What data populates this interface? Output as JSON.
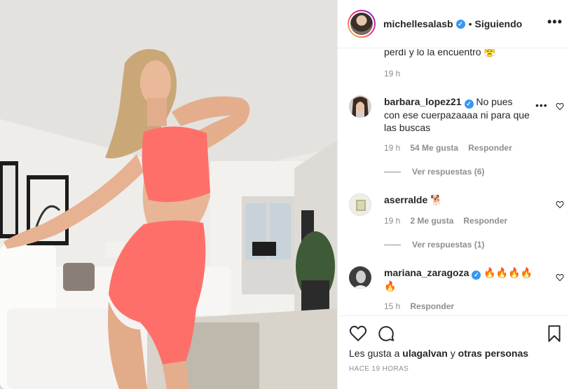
{
  "post": {
    "author": "michellesalasb",
    "verified_mark": "✓",
    "separator": "•",
    "follow_status": "Siguiendo",
    "more_label": "•••"
  },
  "comments": [
    {
      "text": "perdí y lo la encuentro 😤",
      "time": "19 h"
    },
    {
      "user": "barbara_lopez21",
      "text": "No pues con ese cuerpazaaaa ni para que las buscas",
      "time": "19 h",
      "likes": "54 Me gusta",
      "reply": "Responder",
      "view_replies": "Ver respuestas (6)"
    },
    {
      "user": "aserralde",
      "text": "🐕",
      "time": "19 h",
      "likes": "2 Me gusta",
      "reply": "Responder",
      "view_replies": "Ver respuestas (1)"
    },
    {
      "user": "mariana_zaragoza",
      "text": "🔥🔥🔥🔥🔥",
      "time": "15 h",
      "reply": "Responder"
    }
  ],
  "footer": {
    "likes_prefix": "Les gusta a",
    "likes_user": "ulagalvan",
    "likes_connector": "y",
    "likes_others": "otras personas",
    "time_ago": "HACE 19 HORAS"
  },
  "icons": {
    "like": "heart-icon",
    "comment": "comment-icon",
    "save": "bookmark-icon",
    "more": "more-options-icon"
  },
  "colors": {
    "verified": "#3897f0",
    "meta_text": "#8e8e8e",
    "outfit": "#ff6f6a"
  }
}
